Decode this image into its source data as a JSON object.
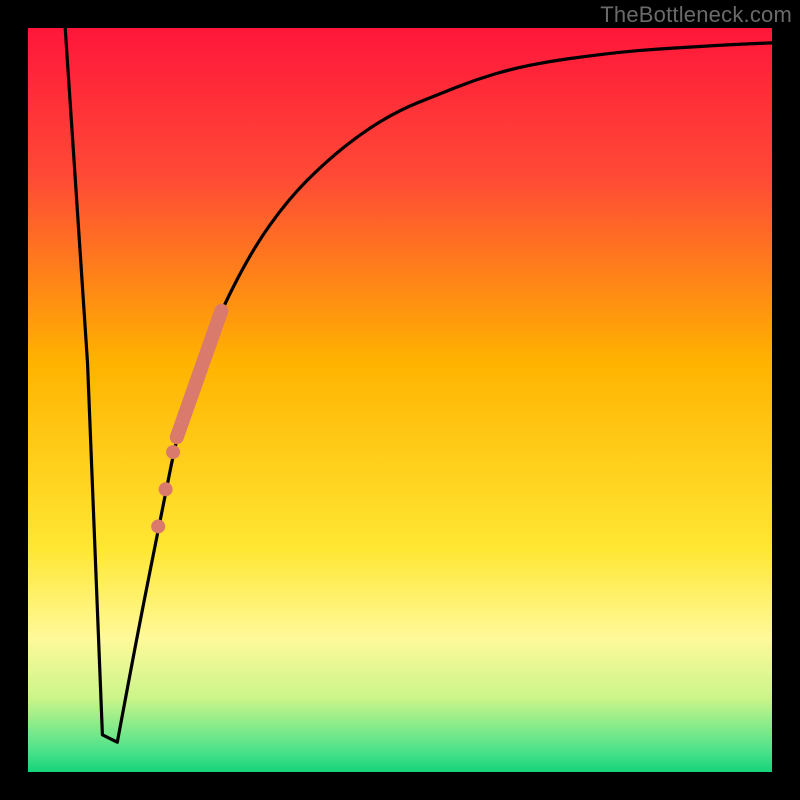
{
  "watermark": "TheBottleneck.com",
  "colors": {
    "frame": "#000000",
    "curve": "#000000",
    "marker": "#d97a6c",
    "gradient_stops": [
      {
        "offset": 0.0,
        "color": "#ff163a"
      },
      {
        "offset": 0.2,
        "color": "#ff4a36"
      },
      {
        "offset": 0.45,
        "color": "#ffb300"
      },
      {
        "offset": 0.7,
        "color": "#ffe733"
      },
      {
        "offset": 0.82,
        "color": "#fff99a"
      },
      {
        "offset": 0.9,
        "color": "#ccf58a"
      },
      {
        "offset": 0.97,
        "color": "#4fe28a"
      },
      {
        "offset": 1.0,
        "color": "#15d47a"
      }
    ]
  },
  "chart_data": {
    "type": "line",
    "title": "",
    "xlabel": "",
    "ylabel": "",
    "xlim": [
      0,
      100
    ],
    "ylim": [
      0,
      100
    ],
    "grid": false,
    "series": [
      {
        "name": "bottleneck-curve",
        "x": [
          5,
          8,
          10,
          12,
          15,
          18,
          20,
          22,
          25,
          30,
          35,
          40,
          45,
          50,
          55,
          60,
          65,
          70,
          75,
          80,
          85,
          90,
          95,
          100
        ],
        "y": [
          100,
          55,
          5,
          4,
          20,
          35,
          45,
          52,
          60,
          70,
          77,
          82,
          86,
          89,
          91,
          93,
          94.5,
          95.5,
          96.2,
          96.8,
          97.2,
          97.5,
          97.8,
          98
        ]
      }
    ],
    "markers": [
      {
        "name": "segment",
        "x_start": 20,
        "x_end": 26,
        "y_start": 45,
        "y_end": 62
      },
      {
        "name": "dot",
        "x": 19.5,
        "y": 43
      },
      {
        "name": "dot",
        "x": 18.5,
        "y": 38
      },
      {
        "name": "dot",
        "x": 17.5,
        "y": 33
      }
    ]
  }
}
